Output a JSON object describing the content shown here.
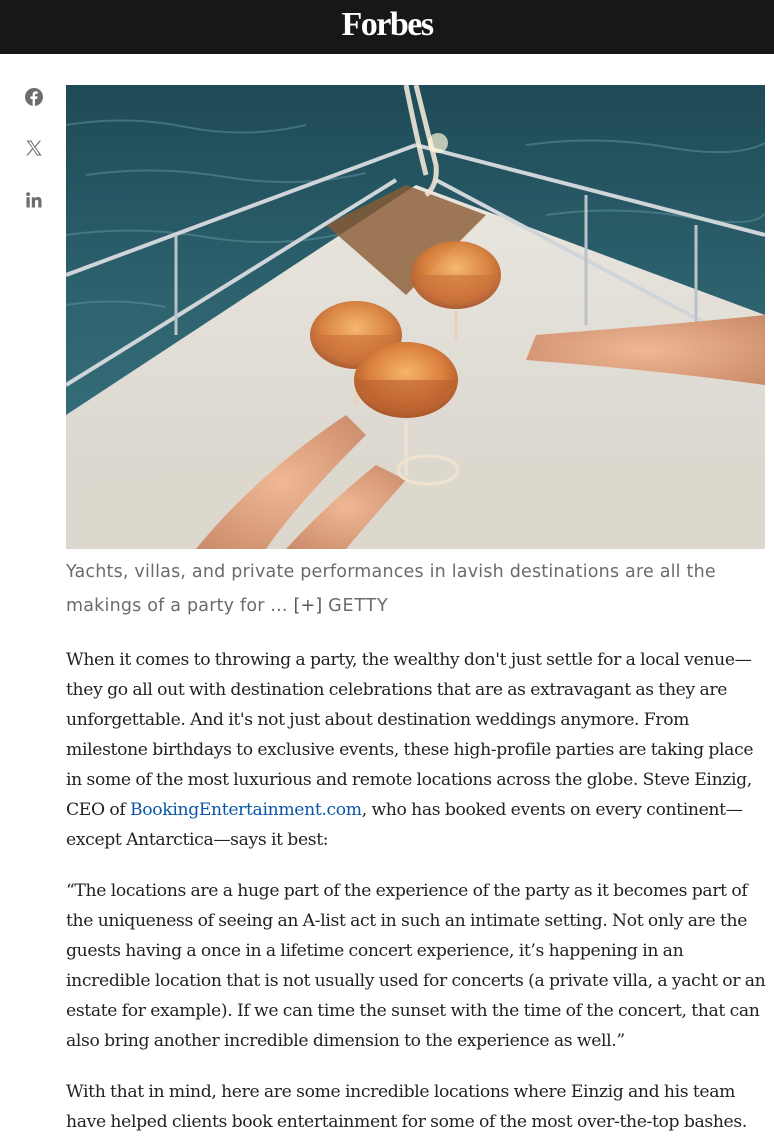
{
  "header": {
    "logo_text": "Forbes",
    "background_color": "#181716"
  },
  "share_bar": {
    "icons": [
      "facebook-icon",
      "x-twitter-icon",
      "linkedin-icon"
    ]
  },
  "hero_image": {
    "description_icon": "yacht-toast-photo"
  },
  "caption": {
    "text": "Yachts, villas, and private performances in lavish destinations are all the makings of a party for ...",
    "expand_label": "[+]",
    "credit": "GETTY"
  },
  "article": {
    "p1_before_link": "When it comes to throwing a party, the wealthy don't just settle for a local venue—they go all out with destination celebrations that are as extravagant as they are unforgettable. And it's not just about destination weddings anymore. From milestone birthdays to exclusive events, these high-profile parties are taking place in some of the most luxurious and remote locations across the globe. Steve Einzig, CEO of ",
    "p1_link": "BookingEntertainment.com",
    "p1_after_link": ", who has booked events on every continent—except Antarctica—says it best:",
    "p2": "“The locations are a huge part of the experience of the party as it becomes part of the uniqueness of seeing an A-list act in such an intimate setting. Not only are the guests having a once in a lifetime concert experience, it’s happening in an incredible location that is not usually used for concerts (a private villa, a yacht or an estate for example). If we can time the sunset with the time of the concert, that can also bring another incredible dimension to the experience as well.”",
    "p3": "With that in mind, here are some incredible locations where Einzig and his team have helped clients book entertainment for some of the most over-the-top bashes.",
    "link_color": "#0a55a8"
  }
}
